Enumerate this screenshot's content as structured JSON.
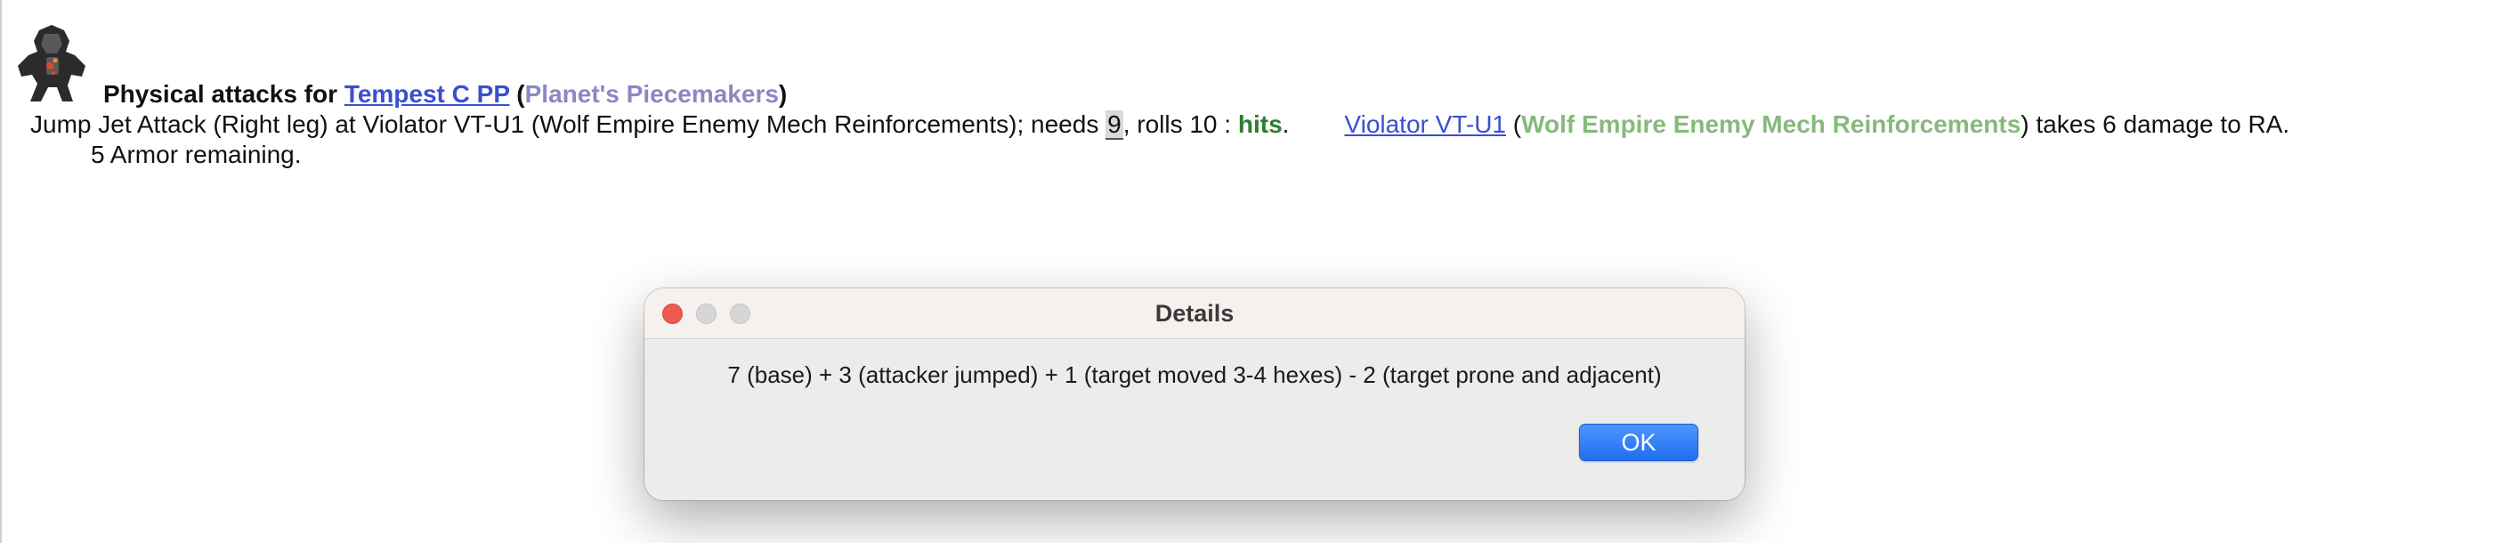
{
  "report": {
    "title_prefix": "Physical attacks for ",
    "attacker_unit": "Tempest C PP",
    "attacker_owner": "Planet's Piecemakers",
    "attack_text": "Jump Jet Attack (Right leg) at Violator VT-U1 (Wolf Empire Enemy Mech Reinforcements); needs ",
    "target_number": "9",
    "roll_text": ", rolls 10 : ",
    "result": "hits",
    "target_unit": "Violator VT-U1",
    "target_owner": "Wolf Empire Enemy Mech Reinforcements",
    "damage_text": " takes 6 damage to RA.",
    "armor_text": "5 Armor remaining."
  },
  "dialog": {
    "title": "Details",
    "message": "7 (base) + 3 (attacker jumped) + 1 (target moved 3-4 hexes) - 2 (target prone and adjacent)",
    "ok_label": "OK"
  },
  "colors": {
    "link": "#3a4fd0",
    "attacker_owner": "#8a88c4",
    "target_owner": "#86b97c",
    "hits": "#2e7d2e",
    "ok_button": "#2a78f5",
    "close_button": "#ee5a52"
  },
  "icons": {
    "unit_icon": "mech-icon"
  }
}
